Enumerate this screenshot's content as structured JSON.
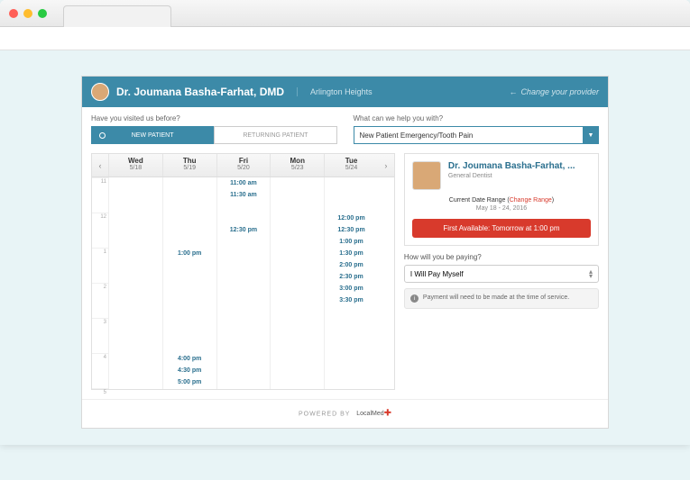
{
  "header": {
    "provider_name": "Dr. Joumana Basha-Farhat, DMD",
    "location": "Arlington Heights",
    "change_provider": "Change your provider"
  },
  "form": {
    "visited_label": "Have you visited us before?",
    "new_patient": "NEW PATIENT",
    "returning_patient": "RETURNING PATIENT",
    "help_label": "What can we help you with?",
    "reason_value": "New Patient Emergency/Tooth Pain"
  },
  "calendar": {
    "days": [
      {
        "name": "Wed",
        "date": "5/18"
      },
      {
        "name": "Thu",
        "date": "5/19"
      },
      {
        "name": "Fri",
        "date": "5/20"
      },
      {
        "name": "Mon",
        "date": "5/23"
      },
      {
        "name": "Tue",
        "date": "5/24"
      }
    ],
    "hours": [
      "11",
      "12",
      "1",
      "2",
      "3",
      "4",
      "5"
    ],
    "slots": {
      "col1": [
        "1:00 pm",
        "4:00 pm",
        "4:30 pm",
        "5:00 pm"
      ],
      "col2": [
        "11:00 am",
        "11:30 am",
        "12:30 pm"
      ],
      "col4": [
        "12:00 pm",
        "12:30 pm",
        "1:00 pm",
        "1:30 pm",
        "2:00 pm",
        "2:30 pm",
        "3:00 pm",
        "3:30 pm"
      ]
    }
  },
  "sidebar": {
    "provider_name": "Dr. Joumana Basha-Farhat, ...",
    "provider_type": "General Dentist",
    "date_range_label": "Current Date Range (",
    "change_range": "Change Range",
    "date_range_close": ")",
    "date_range_value": "May 18 - 24, 2016",
    "first_available": "First Available: Tomorrow at 1:00 pm",
    "pay_label": "How will you be paying?",
    "pay_value": "I Will Pay Myself",
    "pay_note": "Payment will need to be made at the time of service."
  },
  "footer": {
    "powered": "POWERED BY",
    "brand": "LocalMed"
  }
}
